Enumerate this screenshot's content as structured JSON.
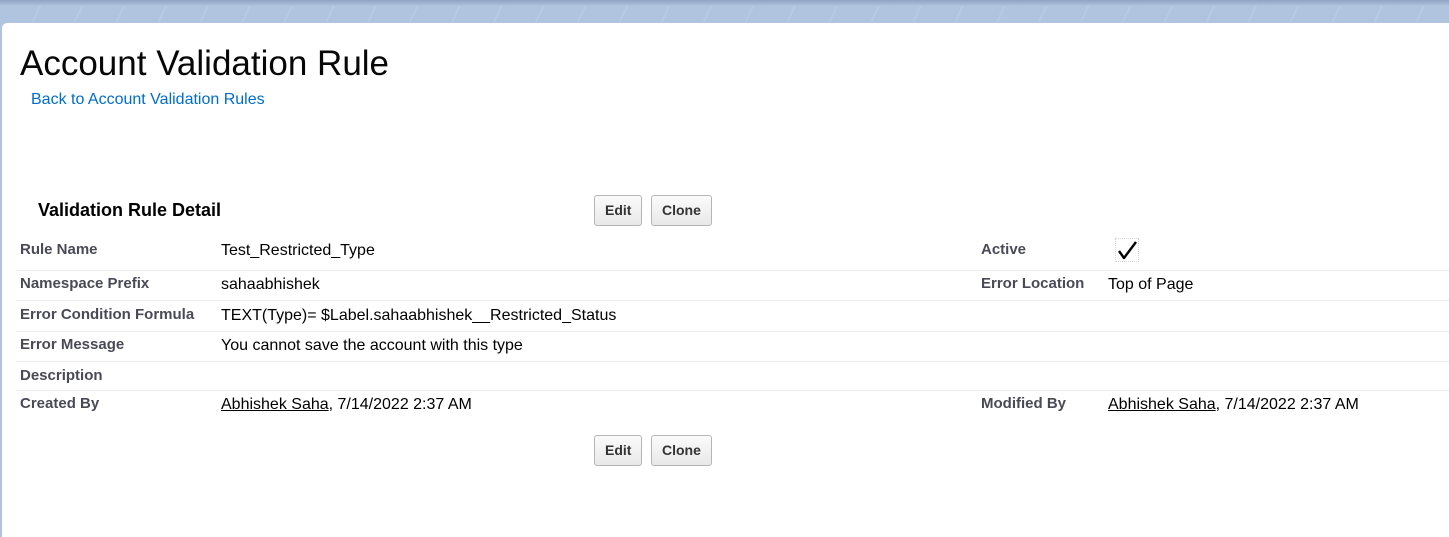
{
  "header": {
    "title": "Account Validation Rule",
    "back_link": "Back to Account Validation Rules"
  },
  "detail": {
    "section_title": "Validation Rule Detail",
    "buttons": {
      "edit": "Edit",
      "clone": "Clone"
    },
    "fields": {
      "rule_name": {
        "label": "Rule Name",
        "value": "Test_Restricted_Type"
      },
      "active": {
        "label": "Active",
        "checked": true
      },
      "namespace_prefix": {
        "label": "Namespace Prefix",
        "value": "sahaabhishek"
      },
      "error_location": {
        "label": "Error Location",
        "value": "Top of Page"
      },
      "error_condition_formula": {
        "label": "Error Condition Formula",
        "value": "TEXT(Type)= $Label.sahaabhishek__Restricted_Status"
      },
      "error_message": {
        "label": "Error Message",
        "value": "You cannot save the account with this type"
      },
      "description": {
        "label": "Description",
        "value": ""
      },
      "created_by": {
        "label": "Created By",
        "user": "Abhishek Saha",
        "date": ", 7/14/2022 2:37 AM"
      },
      "modified_by": {
        "label": "Modified By",
        "user": "Abhishek Saha",
        "date": ", 7/14/2022 2:37 AM"
      }
    }
  }
}
